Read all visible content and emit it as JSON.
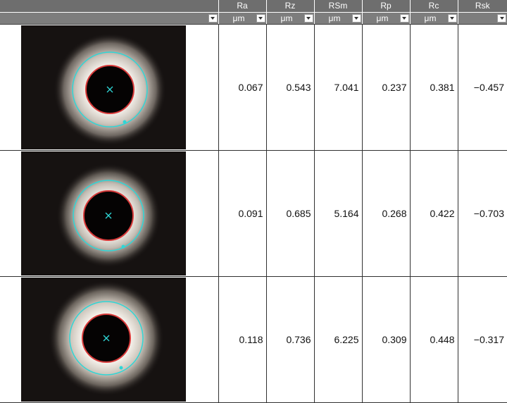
{
  "columns": [
    {
      "name": "Ra",
      "unit": "μm"
    },
    {
      "name": "Rz",
      "unit": "μm"
    },
    {
      "name": "RSm",
      "unit": "μm"
    },
    {
      "name": "Rp",
      "unit": "μm"
    },
    {
      "name": "Rc",
      "unit": "μm"
    },
    {
      "name": "Rsk",
      "unit": ""
    }
  ],
  "rows": [
    {
      "image": "hole-micrograph-1",
      "values": [
        "0.067",
        "0.543",
        "7.041",
        "0.237",
        "0.381",
        "−0.457"
      ]
    },
    {
      "image": "hole-micrograph-2",
      "values": [
        "0.091",
        "0.685",
        "5.164",
        "0.268",
        "0.422",
        "−0.703"
      ]
    },
    {
      "image": "hole-micrograph-3",
      "values": [
        "0.118",
        "0.736",
        "6.225",
        "0.309",
        "0.448",
        "−0.317"
      ]
    }
  ],
  "colors": {
    "header_bg": "#6e6e6e",
    "unit_row_bg": "#7d7d7d",
    "measurement_circle": "#2fd6d6",
    "edge_circle": "#d83a3a",
    "center_marker": "#2fd6d6"
  }
}
